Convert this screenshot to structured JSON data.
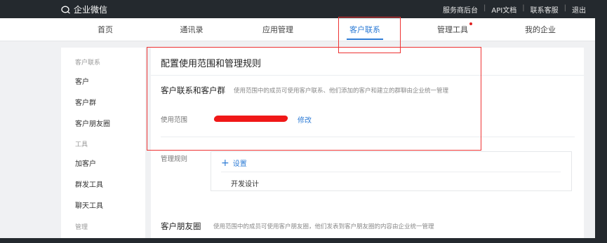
{
  "topbar": {
    "brand": "企业微信",
    "links": [
      "服务商后台",
      "API文档",
      "联系客服",
      "退出"
    ],
    "separator": "|"
  },
  "nav": {
    "tabs": [
      "首页",
      "通讯录",
      "应用管理",
      "客户联系",
      "管理工具",
      "我的企业"
    ],
    "active_tab": "客户联系",
    "badge_tab": "管理工具"
  },
  "sidebar": {
    "groups": [
      {
        "title": "客户联系",
        "items": [
          "客户",
          "客户群",
          "客户朋友圈"
        ]
      },
      {
        "title": "工具",
        "items": [
          "加客户",
          "群发工具",
          "聊天工具"
        ]
      },
      {
        "title": "管理",
        "items": []
      }
    ]
  },
  "main": {
    "page_title": "配置使用范围和管理规则",
    "section1": {
      "title": "客户联系和客户群",
      "description": "使用范围中的成员可使用客户联系、他们添加的客户和建立的群聊由企业统一管理"
    },
    "scope": {
      "label": "使用范围",
      "edit_link": "修改"
    },
    "rules": {
      "label": "管理规则",
      "add_label": "设置",
      "items": [
        "开发设计"
      ]
    },
    "section2": {
      "title": "客户朋友圈",
      "description": "使用范围中的成员可使用客户朋友圈，他们发表到客户朋友圈的内容由企业统一管理"
    }
  },
  "colors": {
    "accent": "#2e7cd6",
    "annotation": "#e33333",
    "topbar": "#24292e"
  },
  "icons": {
    "logo": "wecom-logo-icon",
    "add": "plus-icon",
    "badge": "red-dot"
  }
}
